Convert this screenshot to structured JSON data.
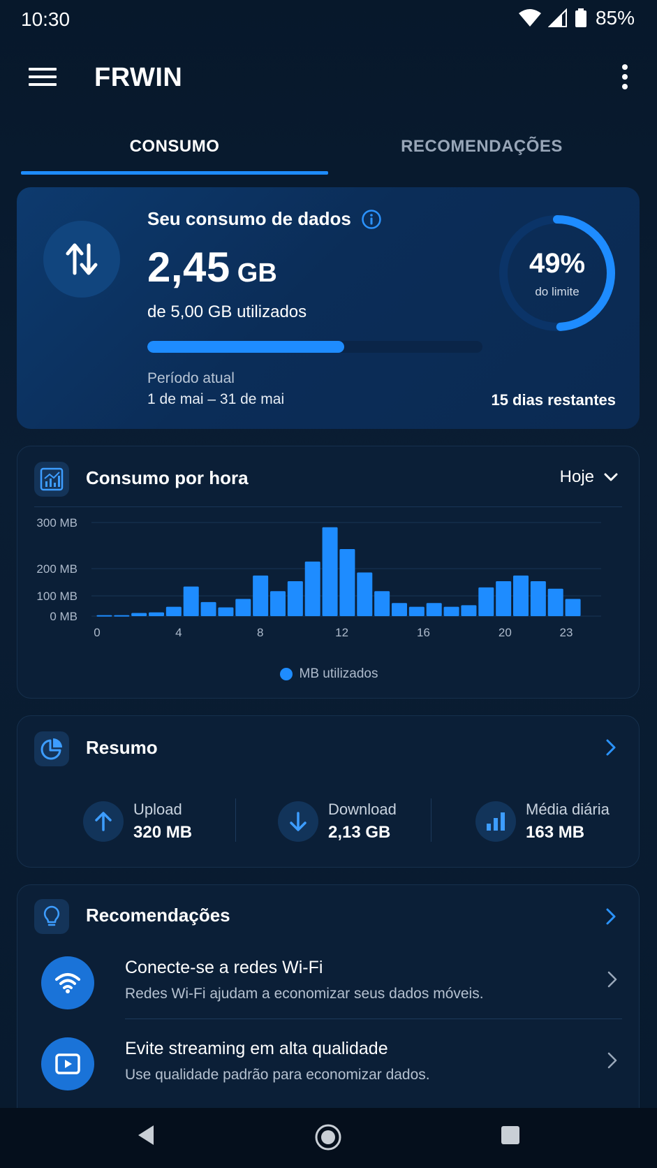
{
  "status": {
    "time": "10:30",
    "battery": "85%"
  },
  "app": {
    "title": "FRWIN"
  },
  "tabs": [
    {
      "label": "CONSUMO",
      "active": true
    },
    {
      "label": "RECOMENDAÇÕES",
      "active": false
    }
  ],
  "summary": {
    "title": "Seu consumo de dados",
    "used_value": "2,45",
    "used_unit": "GB",
    "of_text": "de 5,00 GB utilizados",
    "progress_fraction": 0.49,
    "period_label": "Período atual",
    "period_value": "1 de mai – 31 de mai",
    "days_left": "15 dias restantes",
    "percent_label": "49%",
    "percent_sub": "do limite"
  },
  "hourly": {
    "title": "Consumo por hora",
    "period_select": "Hoje"
  },
  "chart_data": {
    "type": "bar",
    "title": "",
    "xlabel": "",
    "ylabel": "",
    "ylim": [
      0,
      330
    ],
    "y_ticks": [
      {
        "value": 0,
        "label": "0 MB"
      },
      {
        "value": 100,
        "label": "100 MB"
      },
      {
        "value": 200,
        "label": "200 MB"
      },
      {
        "value": 300,
        "label": "300 MB"
      }
    ],
    "x_tick_labels": [
      "0",
      "4",
      "8",
      "12",
      "16",
      "20",
      "23"
    ],
    "x_tick_positions": [
      0,
      4,
      8,
      12,
      16,
      20,
      23
    ],
    "categories": [
      0,
      1,
      2,
      3,
      4,
      5,
      6,
      7,
      8,
      9,
      10,
      11,
      12,
      13,
      14,
      15,
      16,
      17,
      18,
      19,
      20,
      21,
      22,
      23
    ],
    "series": [
      {
        "name": "MB utilizados",
        "values": [
          3,
          3,
          10,
          12,
          30,
          95,
          45,
          28,
          55,
          130,
          80,
          112,
          175,
          285,
          215,
          140,
          80,
          42,
          30,
          42,
          30,
          35,
          92,
          112,
          130,
          112,
          88,
          55
        ],
        "hours": [
          0,
          1,
          2,
          3,
          4,
          5,
          6,
          7,
          8,
          9,
          10,
          11,
          12,
          13,
          14,
          15,
          15.5,
          16,
          17,
          18,
          19,
          19,
          20,
          21,
          22,
          22,
          23,
          23
        ]
      }
    ],
    "color": "#1e8cff",
    "legend": "bottom"
  },
  "resumo": {
    "title": "Resumo",
    "stats": [
      {
        "label": "Upload",
        "value": "320 MB",
        "icon": "arrow-up-icon"
      },
      {
        "label": "Download",
        "value": "2,13 GB",
        "icon": "arrow-down-icon"
      },
      {
        "label": "Média diária",
        "value": "163 MB",
        "icon": "bar-chart-icon"
      }
    ]
  },
  "recommendations": {
    "title": "Recomendações",
    "items": [
      {
        "title": "Conecte-se a redes Wi-Fi",
        "subtitle": "Redes Wi-Fi ajudam a economizar seus dados móveis.",
        "icon": "wifi-icon"
      },
      {
        "title": "Evite streaming em alta qualidade",
        "subtitle": "Use qualidade padrão para economizar dados.",
        "icon": "play-video-icon"
      }
    ]
  },
  "colors": {
    "accent": "#1e8cff",
    "background": "#081a2e",
    "card": "#0b1f37"
  }
}
